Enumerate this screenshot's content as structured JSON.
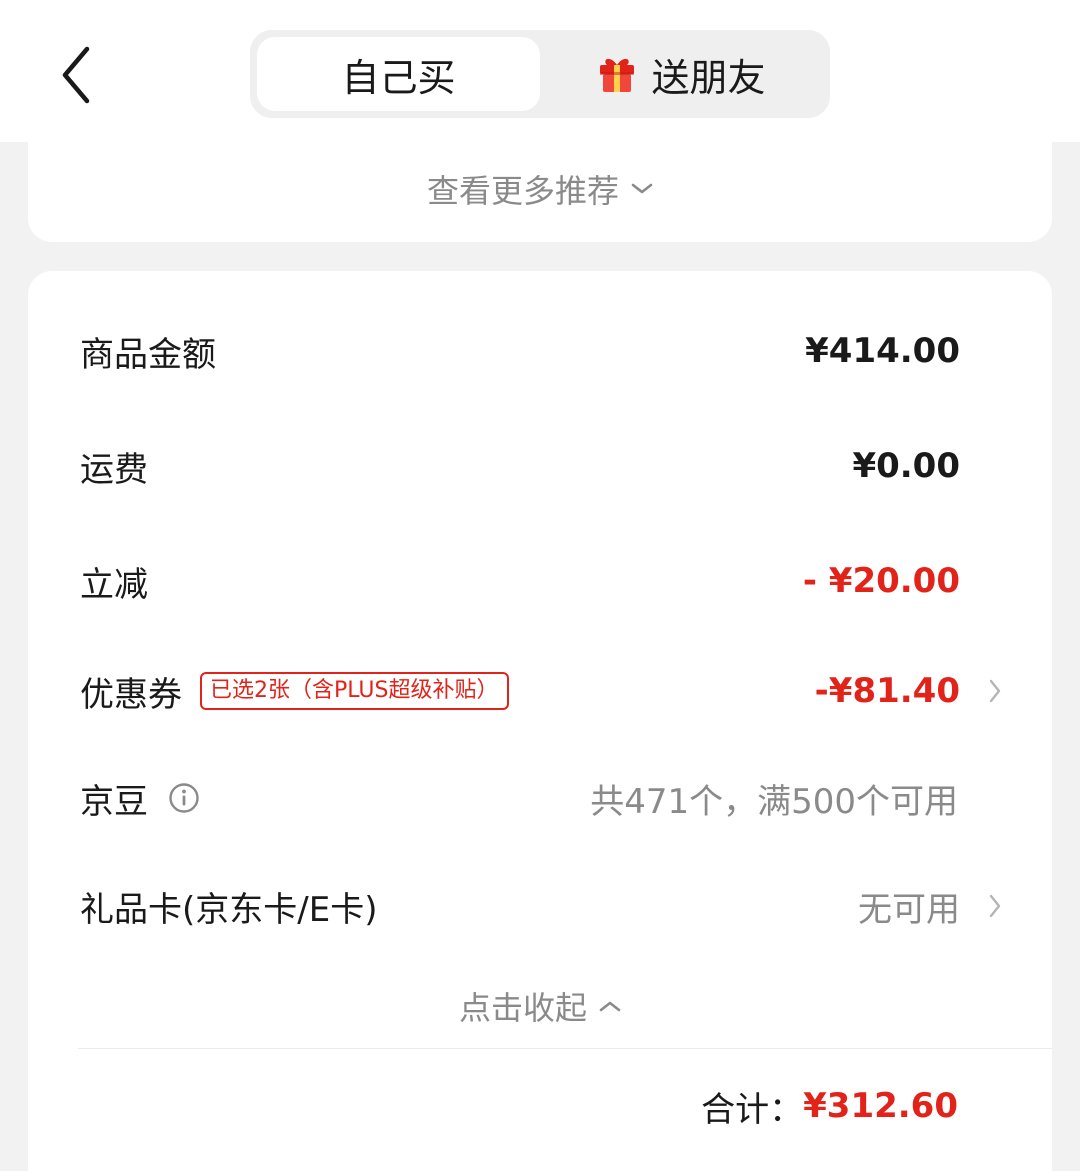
{
  "header": {
    "back_icon": "chevron-left-icon",
    "tabs": [
      {
        "label": "自己买",
        "active": true
      },
      {
        "label": "送朋友",
        "icon": "gift-icon",
        "active": false
      }
    ]
  },
  "recommend": {
    "label": "查看更多推荐",
    "icon": "chevron-down-icon"
  },
  "summary": {
    "rows": [
      {
        "label": "商品金额",
        "value": "¥414.00"
      },
      {
        "label": "运费",
        "value": "¥0.00"
      },
      {
        "label": "立减",
        "value": "- ¥20.00"
      },
      {
        "label": "优惠券",
        "tag": "已选2张（含PLUS超级补贴）",
        "value": "-¥81.40"
      },
      {
        "label": "京豆",
        "value": "共471个，满500个可用",
        "icon": "info-icon"
      },
      {
        "label": "礼品卡(京东卡/E卡)",
        "value": "无可用"
      }
    ],
    "collapse_label": "点击收起",
    "total_label": "合计：",
    "total_value": "¥312.60"
  },
  "colors": {
    "accent_red": "#e2231a",
    "text_dark": "#1a1a1a",
    "text_gray": "#8a8a8a",
    "background": "#f2f2f2"
  }
}
